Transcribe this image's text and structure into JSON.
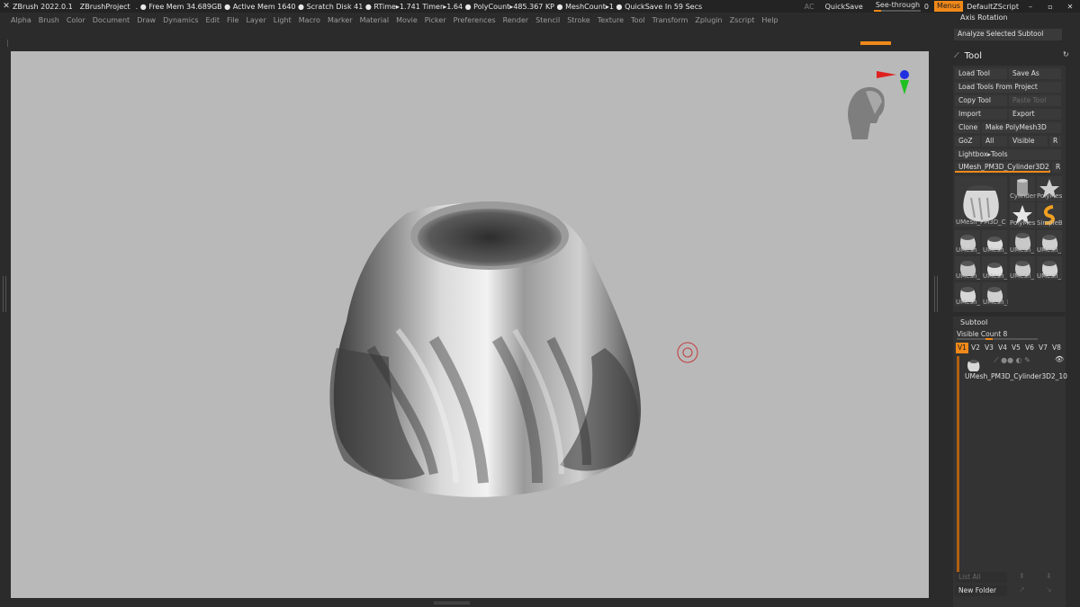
{
  "titlebar": {
    "app": "ZBrush 2022.0.1",
    "project": "ZBrushProject",
    "stats": ". ● Free Mem 34.689GB ● Active Mem 1640 ● Scratch Disk 41 ● RTime▸1.741 Timer▸1.64 ● PolyCount▸485.367 KP ● MeshCount▸1 ● QuickSave In 59 Secs",
    "ac": "AC",
    "quicksave": "QuickSave",
    "seethrough_label": "See-through",
    "seethrough_value": "0",
    "menus": "Menus",
    "script": "DefaultZScript"
  },
  "menus": [
    "Alpha",
    "Brush",
    "Color",
    "Document",
    "Draw",
    "Dynamics",
    "Edit",
    "File",
    "Layer",
    "Light",
    "Macro",
    "Marker",
    "Material",
    "Movie",
    "Picker",
    "Preferences",
    "Render",
    "Stencil",
    "Stroke",
    "Texture",
    "Tool",
    "Transform",
    "Zplugin",
    "Zscript",
    "Help"
  ],
  "right_panel": {
    "axis_rotation": "Axis Rotation",
    "analyze": "Analyze Selected Subtool",
    "tool_title": "Tool",
    "load_tool": "Load Tool",
    "save_as": "Save As",
    "load_from_project": "Load Tools From Project",
    "copy_tool": "Copy Tool",
    "paste_tool": "Paste Tool",
    "import": "Import",
    "export": "Export",
    "clone": "Clone",
    "make_polymesh": "Make PolyMesh3D",
    "goz": "GoZ",
    "all": "All",
    "visible": "Visible",
    "r": "R",
    "lightbox_tools": "Lightbox▸Tools",
    "current_tool": "UMesh_PM3D_Cylinder3D2_1",
    "current_tool_r": "R",
    "thumbs": {
      "main": "UMesh_PM3D_C",
      "cylinder": "Cylinder",
      "polymesh1": "PolyMes",
      "polymesh2": "PolyMes",
      "simplebrush": "SimpleB",
      "u1": "UMesh_",
      "u2": "UMesh_",
      "u3": "UMesh_",
      "u4": "UMesh_",
      "u5": "UMesh_",
      "u6": "UMesh_",
      "u7": "UMesh_",
      "u8": "UMesh_",
      "u9": "UMesh_",
      "u10": "UMesh_PM3D_C"
    },
    "subtool_title": "Subtool",
    "visible_count": "Visible Count 8",
    "vtabs": [
      "V1",
      "V2",
      "V3",
      "V4",
      "V5",
      "V6",
      "V7",
      "V8"
    ],
    "subtool_item": "UMesh_PM3D_Cylinder3D2_10",
    "list_all": "List All",
    "new_folder": "New Folder"
  },
  "colors": {
    "accent": "#f0891a",
    "canvas": "#b9b9b9",
    "panel": "#2b2b2b"
  }
}
